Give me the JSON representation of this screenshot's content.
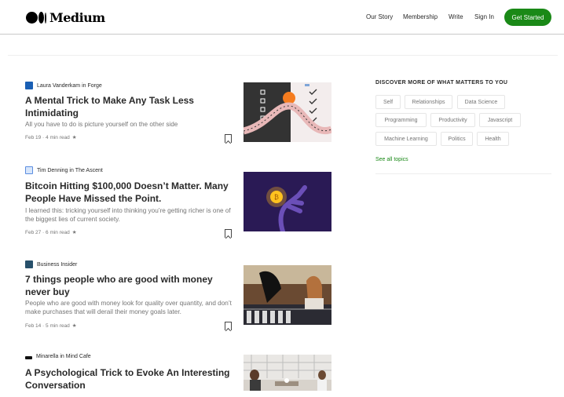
{
  "header": {
    "brand": "Medium",
    "nav": [
      "Our Story",
      "Membership",
      "Write",
      "Sign In"
    ],
    "cta": "Get Started"
  },
  "articles": [
    {
      "author": "Laura Vanderkam",
      "in_word": "in",
      "publication": "Forge",
      "title": "A Mental Trick to Make Any Task Less Intimidating",
      "subtitle": "All you have to do is picture yourself on the other side",
      "date": "Feb 19",
      "read_time": "4 min read",
      "star": "★",
      "pub_icon_color": "#1a5fb4",
      "thumb": "checklist-illustration"
    },
    {
      "author": "Tim Denning",
      "in_word": "in",
      "publication": "The Ascent",
      "title": "Bitcoin Hitting $100,000 Doesn’t Matter. Many People Have Missed the Point.",
      "subtitle": "I learned this: tricking yourself into thinking you’re getting richer is one of the biggest lies of current society.",
      "date": "Feb 27",
      "read_time": "6 min read",
      "star": "★",
      "pub_icon_color": "#5b8de0",
      "thumb": "glowing-coin-hand"
    },
    {
      "author": "Business Insider",
      "in_word": "",
      "publication": "",
      "title": "7 things people who are good with money never buy",
      "subtitle": "People who are good with money look for quality over quantity, and don’t make purchases that will derail their money goals later.",
      "date": "Feb 14",
      "read_time": "5 min read",
      "star": "★",
      "pub_icon_color": "#27506b",
      "thumb": "shopping-photo"
    },
    {
      "author": "Minarella",
      "in_word": "in",
      "publication": "Mind Cafe",
      "title": "A Psychological Trick to Evoke An Interesting Conversation",
      "subtitle": "",
      "date": "",
      "read_time": "",
      "star": "",
      "pub_icon_color": "#111111",
      "thumb": "office-conversation-photo"
    }
  ],
  "sidebar": {
    "title": "DISCOVER MORE OF WHAT MATTERS TO YOU",
    "topics": [
      "Self",
      "Relationships",
      "Data Science",
      "Programming",
      "Productivity",
      "Javascript",
      "Machine Learning",
      "Politics",
      "Health"
    ],
    "see_all": "See all topics"
  }
}
